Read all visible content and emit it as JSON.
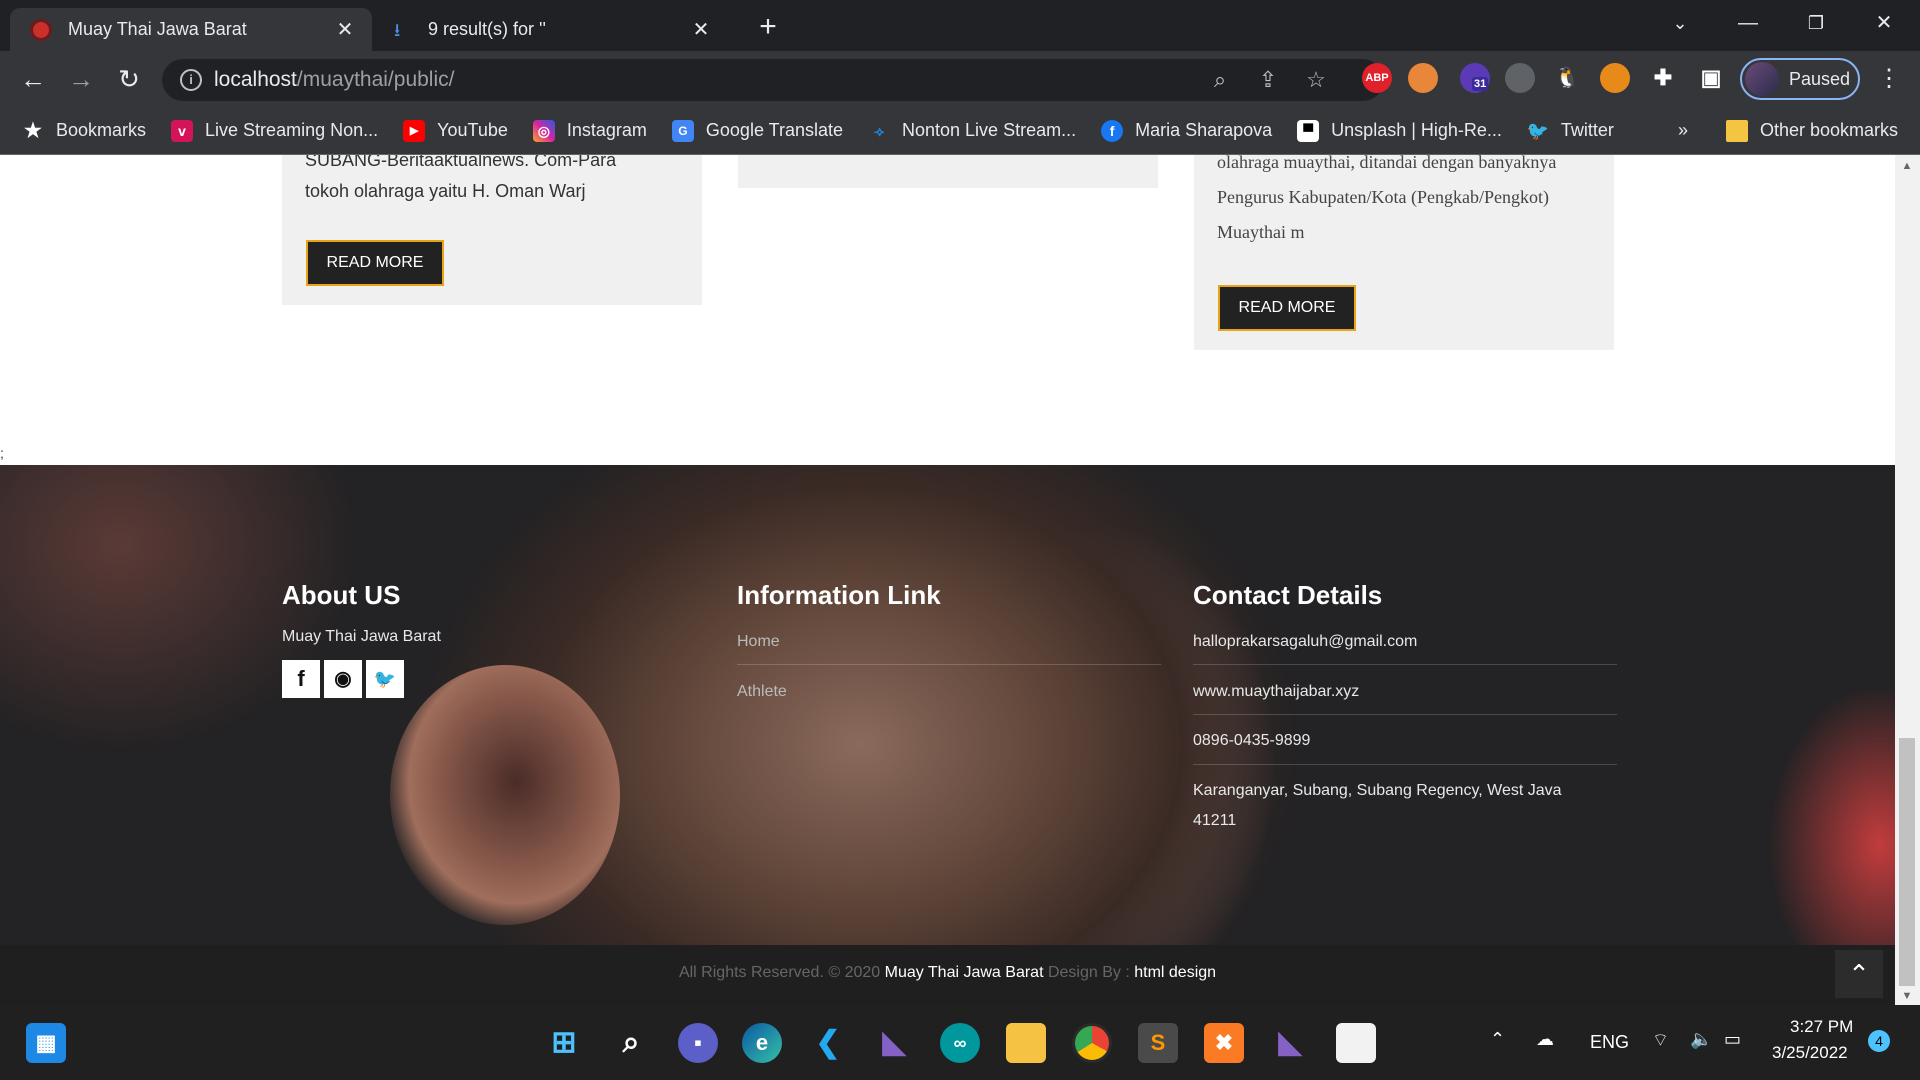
{
  "browser": {
    "tabs": [
      {
        "title": "Muay Thai Jawa Barat",
        "active": true
      },
      {
        "title": "9 result(s) for ''",
        "active": false
      }
    ],
    "url_host": "localhost",
    "url_path": "/muaythai/public/",
    "profile_label": "Paused",
    "ext_abp": "ABP",
    "ext_badge": "31",
    "bookmarks": [
      {
        "label": "Bookmarks",
        "icon": "star-icon"
      },
      {
        "label": "Live Streaming Non...",
        "icon": "vidio-icon"
      },
      {
        "label": "YouTube",
        "icon": "youtube-icon"
      },
      {
        "label": "Instagram",
        "icon": "instagram-icon"
      },
      {
        "label": "Google Translate",
        "icon": "translate-icon"
      },
      {
        "label": "Nonton Live Stream...",
        "icon": "stream-icon"
      },
      {
        "label": "Maria Sharapova",
        "icon": "facebook-icon"
      },
      {
        "label": "Unsplash | High-Re...",
        "icon": "unsplash-icon"
      },
      {
        "label": "Twitter",
        "icon": "twitter-icon"
      }
    ],
    "more_bookmarks": "»",
    "other_bookmarks": "Other bookmarks"
  },
  "page": {
    "card1": {
      "text1": "SUBANG-Beritaaktualnews. Com-Para",
      "text2": "tokoh olahraga yaitu  H. Oman Warj",
      "button": "READ MORE"
    },
    "card3": {
      "text1": "olahraga muaythai, ditandai dengan banyaknya",
      "text2": "Pengurus Kabupaten/Kota (Pengkab/Pengkot)",
      "text3": "Muaythai m",
      "button": "READ MORE"
    },
    "stray_char": ";",
    "footer": {
      "about": {
        "heading": "About US",
        "text": "Muay Thai Jawa Barat"
      },
      "links": {
        "heading": "Information Link",
        "items": [
          "Home",
          "Athlete"
        ]
      },
      "contact": {
        "heading": "Contact Details",
        "email": "halloprakarsagaluh@gmail.com",
        "website": "www.muaythaijabar.xyz",
        "phone": "0896-0435-9899",
        "address1": "Karanganyar, Subang, Subang Regency, West Java",
        "address2": "41211"
      },
      "copyright_pre": "All Rights Reserved. © 2020 ",
      "copyright_brand": "Muay Thai Jawa Barat",
      "copyright_mid": " Design By : ",
      "copyright_design": "html design"
    }
  },
  "taskbar": {
    "language": "ENG",
    "time": "3:27 PM",
    "date": "3/25/2022",
    "notifications": "4"
  },
  "colors": {
    "accent": "#e8a317",
    "dark": "#222222",
    "chrome_bg": "#35363a"
  }
}
